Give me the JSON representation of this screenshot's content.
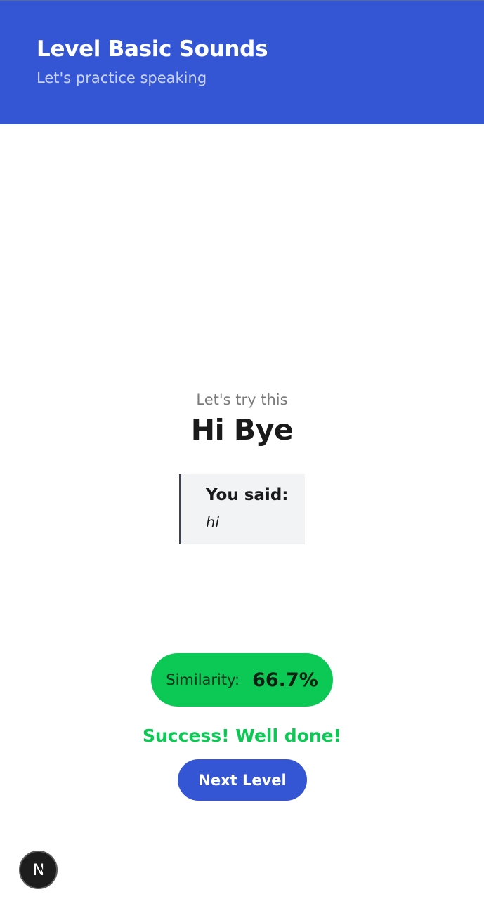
{
  "header": {
    "title": "Level Basic Sounds",
    "subtitle": "Let's practice speaking"
  },
  "prompt": {
    "label": "Let's try this",
    "phrase": "Hi Bye"
  },
  "transcript": {
    "heading": "You said:",
    "value": "hi"
  },
  "similarity": {
    "label": "Similarity:",
    "value": "66.7%"
  },
  "result": {
    "message": "Success! Well done!"
  },
  "actions": {
    "next_label": "Next Level"
  },
  "dev_badge": {
    "icon": "nextjs-logo-icon",
    "glyph": "N"
  },
  "colors": {
    "primary": "#3556d4",
    "success": "#0cc955"
  }
}
